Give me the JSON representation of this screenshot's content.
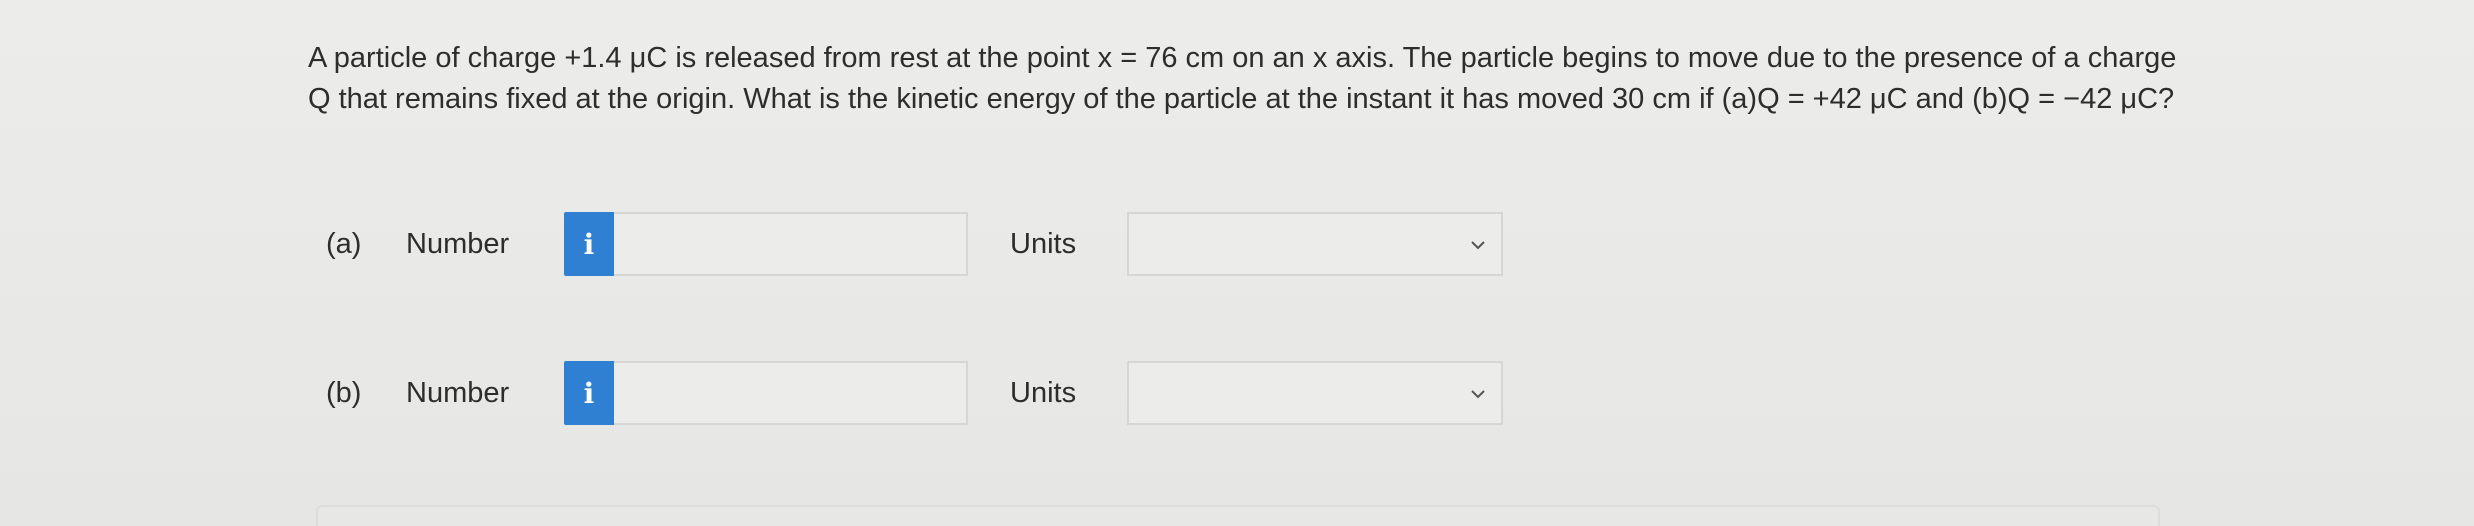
{
  "question": {
    "text": "A particle of charge +1.4 μC is released from rest at the point x = 76 cm on an x axis. The particle begins to move due to the presence of a charge Q that remains fixed at the origin. What is the kinetic energy of the particle at the instant it has moved 30 cm if (a)Q = +42 μC and (b)Q = −42 μC?"
  },
  "parts": [
    {
      "label": "(a)",
      "number_label": "Number",
      "info_icon": "i",
      "number_value": "",
      "units_label": "Units",
      "units_value": ""
    },
    {
      "label": "(b)",
      "number_label": "Number",
      "info_icon": "i",
      "number_value": "",
      "units_label": "Units",
      "units_value": ""
    }
  ],
  "colors": {
    "info_button": "#2f7fd3",
    "background": "#e9e9e7"
  }
}
